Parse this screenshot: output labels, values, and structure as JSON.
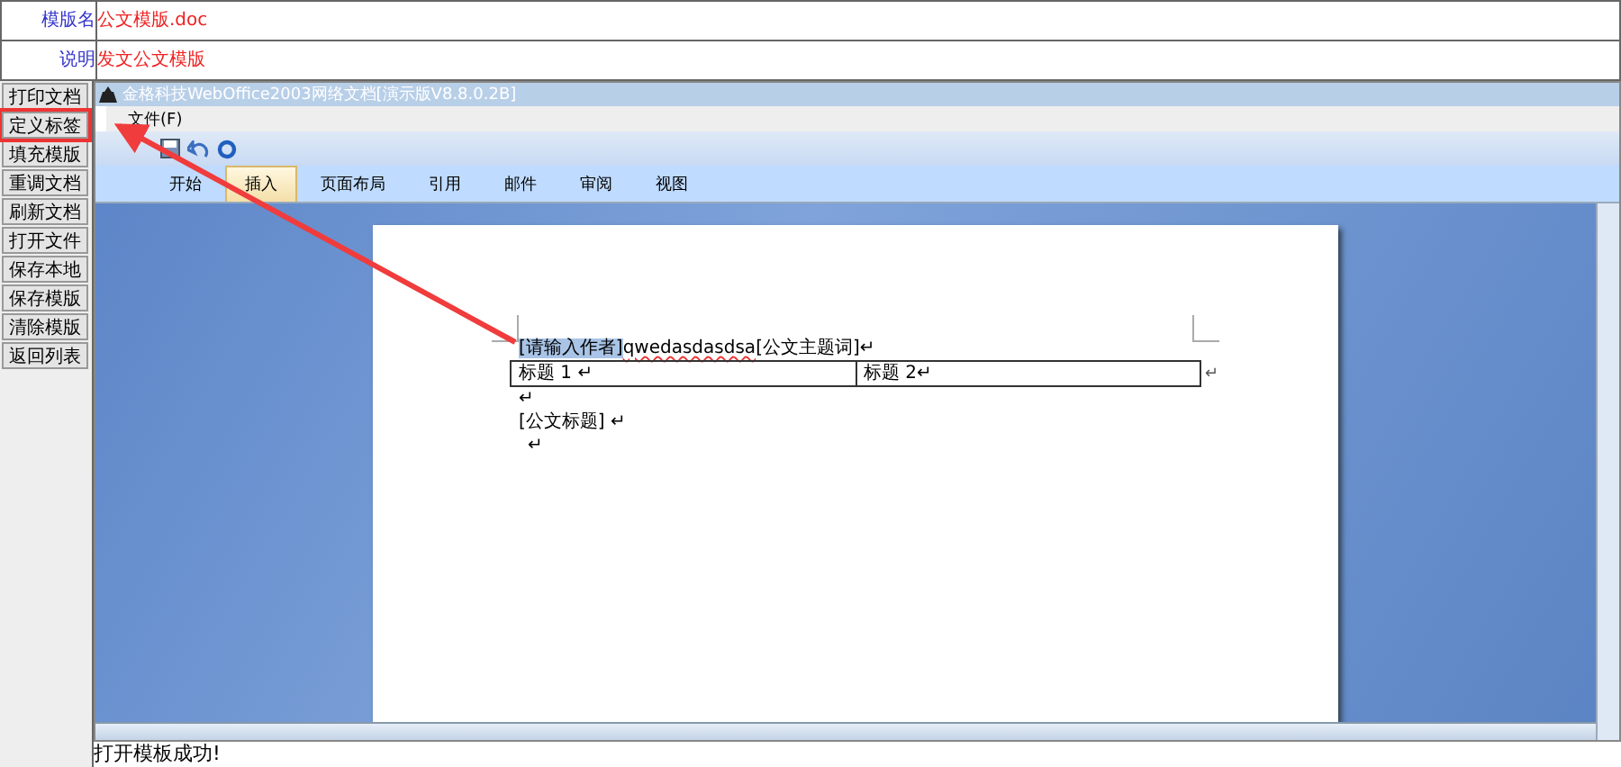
{
  "form": [
    {
      "label": "模版名",
      "value": "公文模版.doc"
    },
    {
      "label": "说明",
      "value": "发文公文模版"
    }
  ],
  "buttons": [
    {
      "label": "打印文档",
      "selected": false
    },
    {
      "label": "定义标签",
      "selected": true
    },
    {
      "label": "填充模版",
      "selected": false
    },
    {
      "label": "重调文档",
      "selected": false
    },
    {
      "label": "刷新文档",
      "selected": false
    },
    {
      "label": "打开文件",
      "selected": false
    },
    {
      "label": "保存本地",
      "selected": false
    },
    {
      "label": "保存模版",
      "selected": false
    },
    {
      "label": "清除模版",
      "selected": false
    },
    {
      "label": "返回列表",
      "selected": false
    }
  ],
  "word": {
    "title": "金格科技WebOffice2003网络文档[演示版V8.8.0.2B]",
    "menu": [
      "文件(F)"
    ],
    "ribbon_tabs": [
      {
        "label": "开始",
        "selected": false
      },
      {
        "label": "插入",
        "selected": true
      },
      {
        "label": "页面布局",
        "selected": false
      },
      {
        "label": "引用",
        "selected": false
      },
      {
        "label": "邮件",
        "selected": false
      },
      {
        "label": "审阅",
        "selected": false
      },
      {
        "label": "视图",
        "selected": false
      }
    ],
    "document": [
      {
        "kind": "runs",
        "runs": [
          {
            "kind": "highlight",
            "text": "[请输入作者]"
          },
          {
            "kind": "typo",
            "text": "qwedasdasdsa"
          },
          {
            "kind": "plain",
            "text": "[公文主题词]↵"
          }
        ]
      },
      {
        "kind": "table",
        "cells": [
          "标题 1 ↵",
          "标题 2↵"
        ],
        "end": "↵"
      },
      {
        "kind": "text",
        "text": "↵"
      },
      {
        "kind": "text",
        "text": "[公文标题] ↵"
      },
      {
        "kind": "text",
        "text": "↵",
        "indent": true
      }
    ]
  },
  "status": "打开模板成功!"
}
